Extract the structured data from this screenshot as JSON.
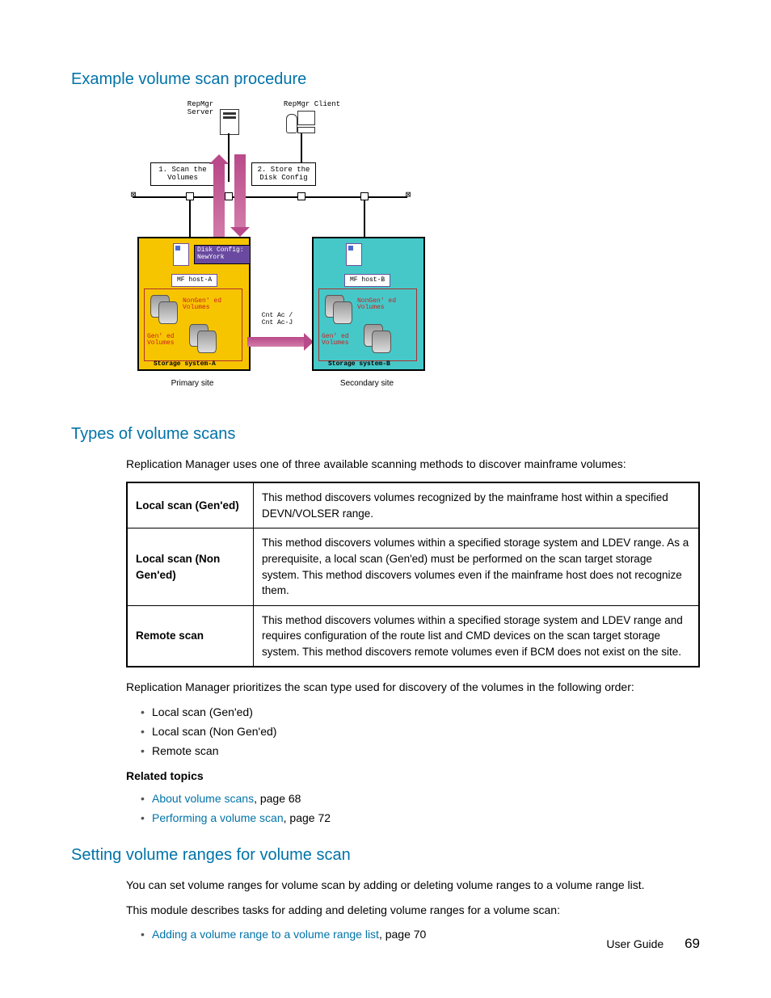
{
  "headings": {
    "h1": "Example volume scan procedure",
    "h2": "Types of volume scans",
    "h3": "Setting volume ranges for volume scan"
  },
  "diagram": {
    "repmgr_server": "RepMgr\nServer",
    "repmgr_client": "RepMgr Client",
    "step1": "1. Scan the\nVolumes",
    "step2": "2. Store the\nDisk Config",
    "disk_config": "Disk Config:\nNewYork",
    "mf_host_a": "MF host-A",
    "mf_host_b": "MF host-B",
    "nongen_vol": "NonGen' ed\nVolumes",
    "gen_vol": "Gen' ed\nVolumes",
    "link": "Cnt Ac /\nCnt Ac-J",
    "sys_a": "Storage system-A",
    "sys_b": "Storage system-B",
    "primary": "Primary site",
    "secondary": "Secondary site"
  },
  "types_intro": "Replication Manager uses one of three available scanning methods to discover mainframe volumes:",
  "table": {
    "r1": {
      "label": "Local scan (Gen'ed)",
      "desc": "This method discovers volumes recognized by the mainframe host within a specified DEVN/VOLSER range."
    },
    "r2": {
      "label": "Local scan (Non Gen'ed)",
      "desc": "This method discovers volumes within a specified storage system and LDEV range. As a prerequisite, a local scan (Gen'ed) must be performed on the scan target storage system. This method discovers volumes even if the mainframe host does not recognize them."
    },
    "r3": {
      "label": "Remote scan",
      "desc": "This method discovers volumes within a specified storage system and LDEV range and requires configuration of the route list and CMD devices on the scan target storage system. This method discovers remote volumes even if BCM does not exist on the site."
    }
  },
  "priority_intro": "Replication Manager prioritizes the scan type used for discovery of the volumes in the following order:",
  "priority_list": [
    "Local scan (Gen'ed)",
    "Local scan (Non Gen'ed)",
    "Remote scan"
  ],
  "related_h": "Related topics",
  "related": [
    {
      "link": "About volume scans",
      "rest": ", page 68"
    },
    {
      "link": "Performing a volume scan",
      "rest": ", page 72"
    }
  ],
  "setting_p1": "You can set volume ranges for volume scan by adding or deleting volume ranges to a volume range list.",
  "setting_p2": "This module describes tasks for adding and deleting volume ranges for a volume scan:",
  "setting_list": [
    {
      "link": "Adding a volume range to a volume range list",
      "rest": ", page 70"
    }
  ],
  "footer": {
    "title": "User Guide",
    "page": "69"
  }
}
